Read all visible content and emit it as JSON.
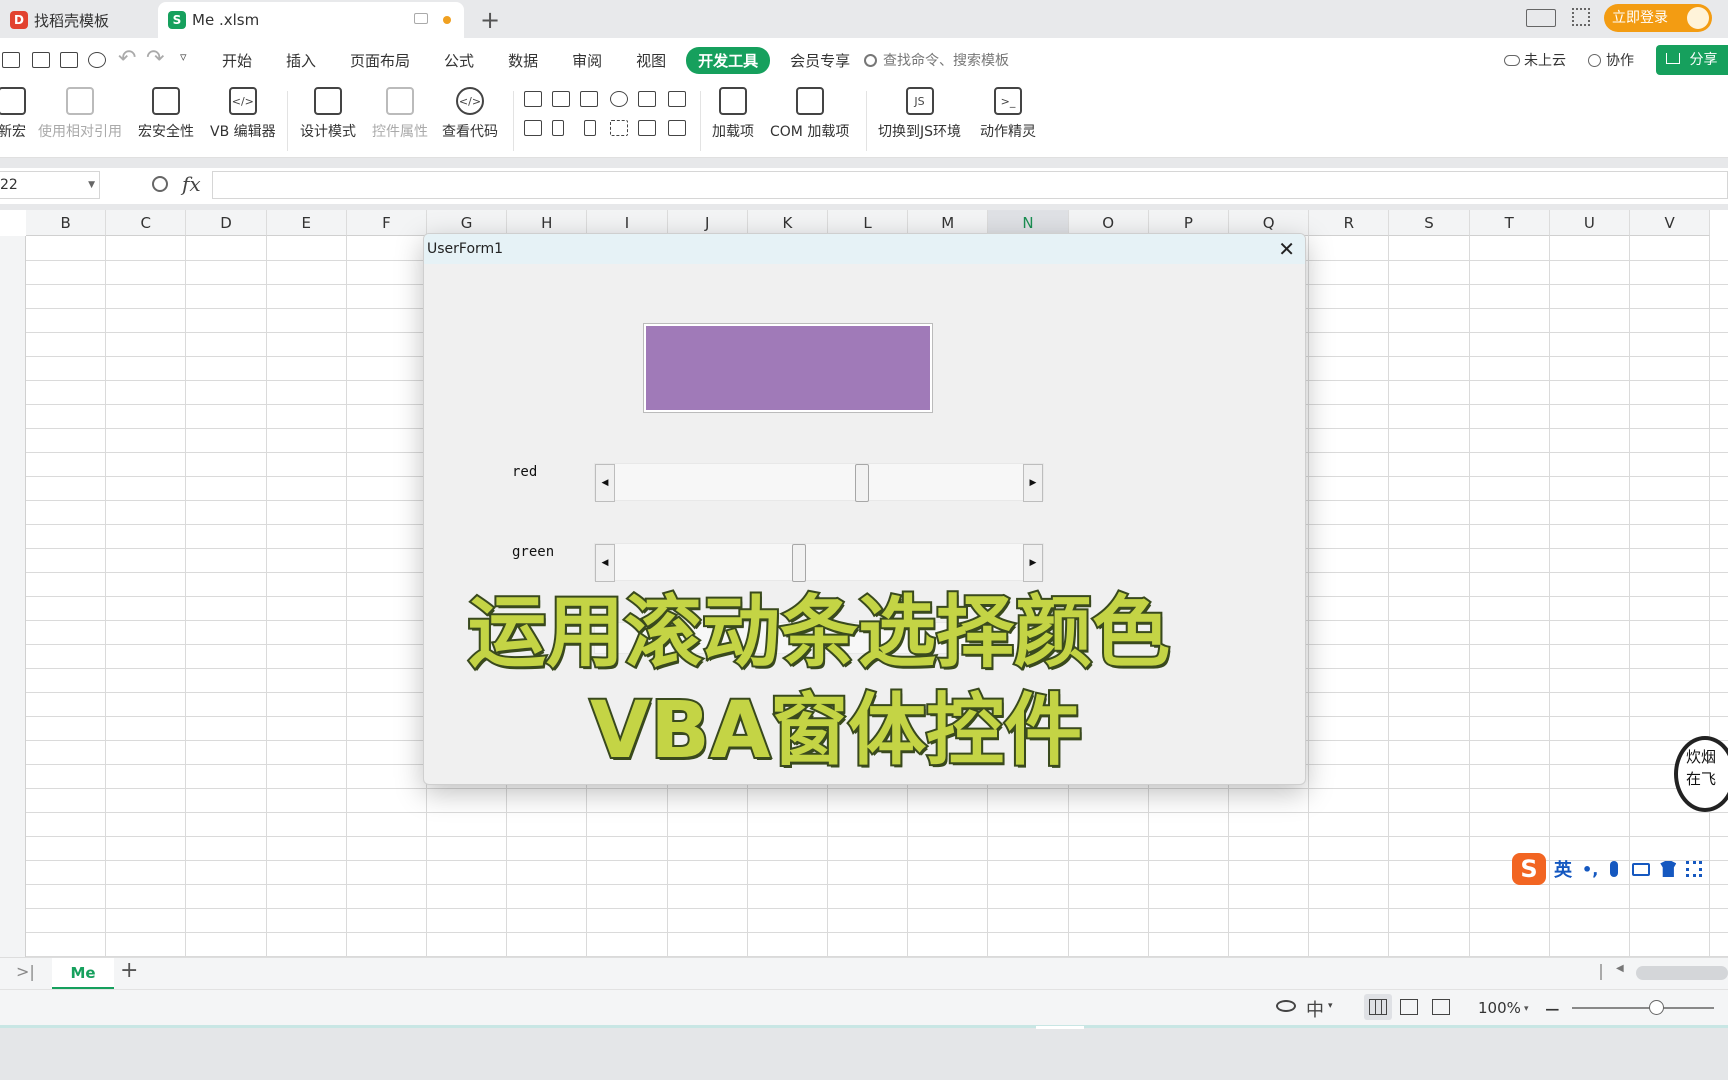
{
  "tabs": [
    {
      "label": "找稻壳模板",
      "logo": "D"
    },
    {
      "label": "Me .xlsm",
      "logo": "S"
    }
  ],
  "new_tab_icon": "plus-icon",
  "login_label": "立即登录",
  "menu": {
    "items": [
      "开始",
      "插入",
      "页面布局",
      "公式",
      "数据",
      "审阅",
      "视图",
      "开发工具",
      "会员专享"
    ],
    "active": "开发工具",
    "search_placeholder": "查找命令、搜索模板",
    "cloud_label": "未上云",
    "collab_label": "协作",
    "share_label": "分享"
  },
  "ribbon": {
    "buttons": [
      {
        "label": "新宏",
        "disabled": false
      },
      {
        "label": "使用相对引用",
        "disabled": true
      },
      {
        "label": "宏安全性",
        "disabled": false
      },
      {
        "label": "VB 编辑器",
        "disabled": false
      },
      {
        "label": "设计模式",
        "disabled": false
      },
      {
        "label": "控件属性",
        "disabled": true
      },
      {
        "label": "查看代码",
        "disabled": false
      },
      {
        "label": "加载项",
        "disabled": false
      },
      {
        "label": "COM 加载项",
        "disabled": false
      },
      {
        "label": "切换到JS环境",
        "disabled": false
      },
      {
        "label": "动作精灵",
        "disabled": false
      }
    ]
  },
  "formula_bar": {
    "cell_ref": "22",
    "fx_label": "fx"
  },
  "columns": [
    "B",
    "C",
    "D",
    "E",
    "F",
    "G",
    "H",
    "I",
    "J",
    "K",
    "L",
    "M",
    "N",
    "O",
    "P",
    "Q",
    "R",
    "S",
    "T",
    "U",
    "V"
  ],
  "selected_column": "N",
  "dialog": {
    "title": "UserForm1",
    "preview_color": "#a07ab8",
    "scrollbars": [
      {
        "label": "red",
        "value_fraction": 0.61
      },
      {
        "label": "green",
        "value_fraction": 0.45
      }
    ]
  },
  "overlay": {
    "line1": "运用滚动条选择颜色",
    "line2": "VBA窗体控件"
  },
  "watermark": "炊烟在飞",
  "ime": {
    "lang": "英",
    "punct": "•,"
  },
  "sheet": {
    "name": "Me"
  },
  "status": {
    "zoom": "100%"
  }
}
